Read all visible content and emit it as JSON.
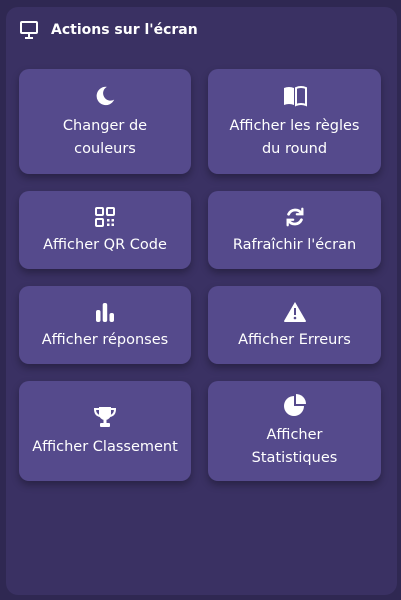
{
  "header": {
    "title": "Actions sur l'écran",
    "icon": "presentation-screen-icon"
  },
  "actions": [
    {
      "label": "Changer de\ncouleurs",
      "icon": "moon-icon"
    },
    {
      "label": "Afficher les règles\ndu round",
      "icon": "book-icon"
    },
    {
      "label": "Afficher QR Code",
      "icon": "qr-code-icon"
    },
    {
      "label": "Rafraîchir l'écran",
      "icon": "refresh-icon"
    },
    {
      "label": "Afficher réponses",
      "icon": "bar-chart-icon"
    },
    {
      "label": "Afficher Erreurs",
      "icon": "warning-icon"
    },
    {
      "label": "Afficher Classement",
      "icon": "trophy-icon"
    },
    {
      "label": "Afficher\nStatistiques",
      "icon": "pie-chart-icon"
    }
  ],
  "colors": {
    "background": "#2f2852",
    "panel": "#3a3163",
    "tile": "#554a8c",
    "text": "#ffffff"
  }
}
